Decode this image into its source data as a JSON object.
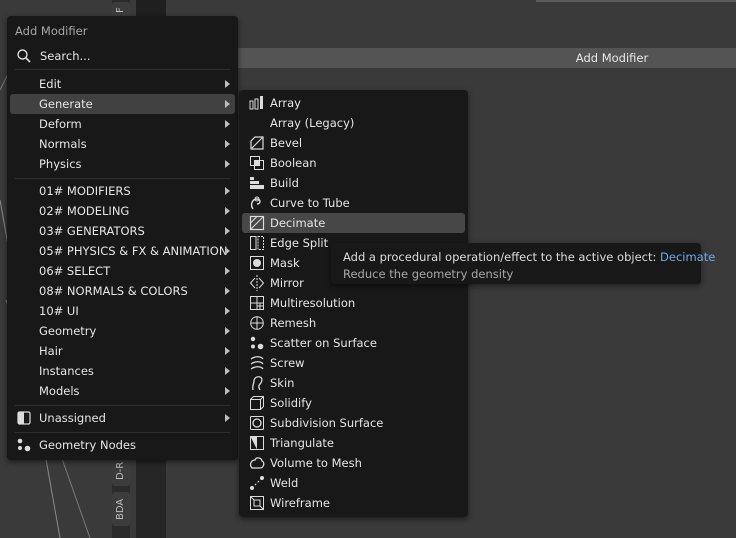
{
  "background": {
    "header_label": "Add Modifier",
    "side_tabs": [
      "F",
      "D-R",
      "BDA"
    ]
  },
  "main_menu": {
    "title": "Add Modifier",
    "search_placeholder": "Search...",
    "items": [
      {
        "label": "Edit",
        "submenu": true
      },
      {
        "label": "Generate",
        "submenu": true,
        "highlighted": true
      },
      {
        "label": "Deform",
        "submenu": true
      },
      {
        "label": "Normals",
        "submenu": true
      },
      {
        "label": "Physics",
        "submenu": true
      },
      {
        "label": "01# MODIFIERS",
        "submenu": true
      },
      {
        "label": "02# MODELING",
        "submenu": true
      },
      {
        "label": "03# GENERATORS",
        "submenu": true
      },
      {
        "label": "05# PHYSICS & FX & ANIMATION",
        "submenu": true
      },
      {
        "label": "06# SELECT",
        "submenu": true
      },
      {
        "label": "08# NORMALS & COLORS",
        "submenu": true
      },
      {
        "label": "10# UI",
        "submenu": true
      },
      {
        "label": "Geometry",
        "submenu": true
      },
      {
        "label": "Hair",
        "submenu": true
      },
      {
        "label": "Instances",
        "submenu": true
      },
      {
        "label": "Models",
        "submenu": true
      },
      {
        "label": "Unassigned",
        "submenu": true,
        "icon": "unassigned-icon"
      },
      {
        "label": "Geometry Nodes",
        "submenu": false,
        "icon": "geometry-nodes-icon"
      }
    ]
  },
  "generate_menu": {
    "items": [
      {
        "label": "Array",
        "icon": "array-icon"
      },
      {
        "label": "Array (Legacy)",
        "icon": ""
      },
      {
        "label": "Bevel",
        "icon": "bevel-icon"
      },
      {
        "label": "Boolean",
        "icon": "boolean-icon"
      },
      {
        "label": "Build",
        "icon": "build-icon"
      },
      {
        "label": "Curve to Tube",
        "icon": "curve-to-tube-icon"
      },
      {
        "label": "Decimate",
        "icon": "decimate-icon",
        "highlighted": true
      },
      {
        "label": "Edge Split",
        "icon": "edge-split-icon"
      },
      {
        "label": "Mask",
        "icon": "mask-icon"
      },
      {
        "label": "Mirror",
        "icon": "mirror-icon"
      },
      {
        "label": "Multiresolution",
        "icon": "multiresolution-icon"
      },
      {
        "label": "Remesh",
        "icon": "remesh-icon"
      },
      {
        "label": "Scatter on Surface",
        "icon": "scatter-icon"
      },
      {
        "label": "Screw",
        "icon": "screw-icon"
      },
      {
        "label": "Skin",
        "icon": "skin-icon"
      },
      {
        "label": "Solidify",
        "icon": "solidify-icon"
      },
      {
        "label": "Subdivision Surface",
        "icon": "subdivision-surface-icon"
      },
      {
        "label": "Triangulate",
        "icon": "triangulate-icon"
      },
      {
        "label": "Volume to Mesh",
        "icon": "volume-to-mesh-icon"
      },
      {
        "label": "Weld",
        "icon": "weld-icon"
      },
      {
        "label": "Wireframe",
        "icon": "wireframe-icon"
      }
    ]
  },
  "tooltip": {
    "prefix": "Add a procedural operation/effect to the active object: ",
    "operator": "Decimate",
    "description": "Reduce the geometry density"
  },
  "colors": {
    "menu_bg": "#181818",
    "highlight": "#414141",
    "accent": "#71a8e6"
  }
}
